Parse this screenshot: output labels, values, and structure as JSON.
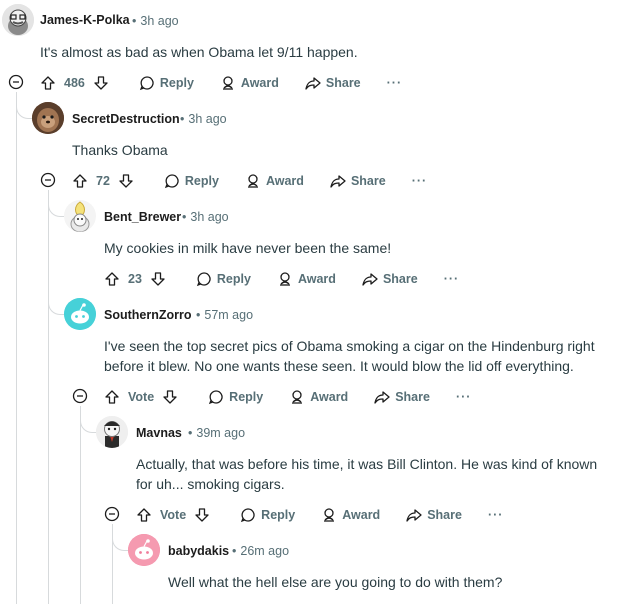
{
  "comments": [
    {
      "username": "James-K-Polka",
      "time": "3h ago",
      "body": "It's almost as bad as when Obama let 9/11 happen.",
      "score": "486",
      "reply": "Reply",
      "award": "Award",
      "share": "Share",
      "more": "···"
    },
    {
      "username": "SecretDestruction",
      "time": "3h ago",
      "body": "Thanks Obama",
      "score": "72",
      "reply": "Reply",
      "award": "Award",
      "share": "Share",
      "more": "···"
    },
    {
      "username": "Bent_Brewer",
      "time": "3h ago",
      "body": "My cookies in milk have never been the same!",
      "score": "23",
      "reply": "Reply",
      "award": "Award",
      "share": "Share",
      "more": "···"
    },
    {
      "username": "SouthernZorro",
      "time": "57m ago",
      "body": "I've seen the top secret pics of Obama smoking a cigar on the Hindenburg right before it blew. No one wants these seen. It would blow the lid off everything.",
      "score": "Vote",
      "reply": "Reply",
      "award": "Award",
      "share": "Share",
      "more": "···"
    },
    {
      "username": "Mavnas",
      "time": "39m ago",
      "body": "Actually, that was before his time, it was Bill Clinton. He was kind of known for uh... smoking cigars.",
      "score": "Vote",
      "reply": "Reply",
      "award": "Award",
      "share": "Share",
      "more": "···"
    },
    {
      "username": "babydakis",
      "time": "26m ago",
      "body": "Well what the hell else are you going to do with them?"
    }
  ],
  "colors": {
    "meta": "#576f76",
    "thread": "#d7dadc",
    "teal": "#46d1d8",
    "pink": "#f07c9a"
  }
}
